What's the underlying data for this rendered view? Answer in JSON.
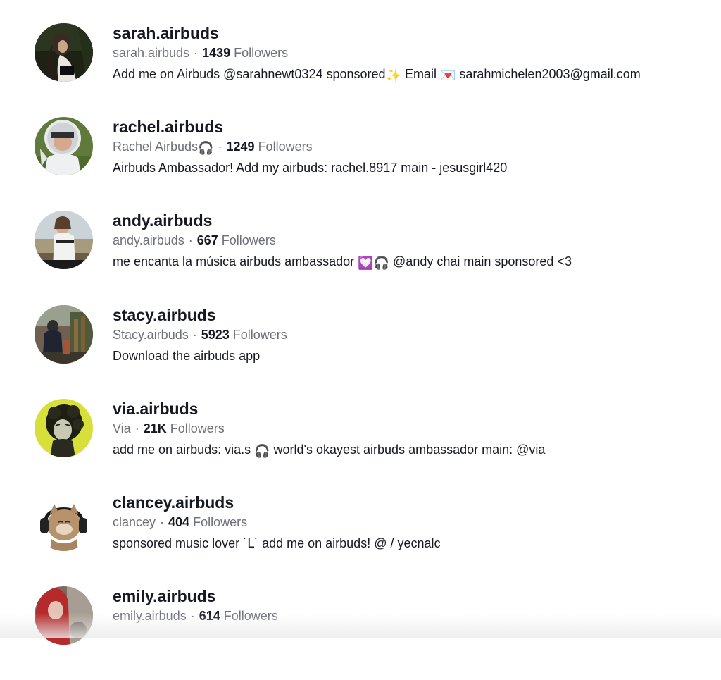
{
  "accounts": [
    {
      "username": "sarah.airbuds",
      "display_name": "sarah.airbuds",
      "followers_count": "1439",
      "followers_label": "Followers",
      "bio_parts": [
        "Add me on Airbuds @sarahnewt0324 sponsored",
        "✨",
        " Email ",
        "💌",
        " sarahmichelen2003@gmail.com"
      ],
      "avatar_icon": "woman-portrait-dark-avatar"
    },
    {
      "username": "rachel.airbuds",
      "display_name": "Rachel Airbuds",
      "display_emoji": "🎧",
      "followers_count": "1249",
      "followers_label": "Followers",
      "bio": "Airbuds Ambassador! Add my airbuds: rachel.8917 main - jesusgirl420",
      "avatar_icon": "helmet-girl-avatar"
    },
    {
      "username": "andy.airbuds",
      "display_name": "andy.airbuds",
      "followers_count": "667",
      "followers_label": "Followers",
      "bio_parts": [
        "me encanta la música airbuds ambassador ",
        "💟",
        "🎧",
        " @andy chai main sponsored <3"
      ],
      "avatar_icon": "girl-beach-avatar"
    },
    {
      "username": "stacy.airbuds",
      "display_name": "Stacy.airbuds",
      "followers_count": "5923",
      "followers_label": "Followers",
      "bio": "Download the airbuds app",
      "avatar_icon": "market-scene-avatar"
    },
    {
      "username": "via.airbuds",
      "display_name": "Via",
      "followers_count": "21K",
      "followers_label": "Followers",
      "bio_parts": [
        "add me on airbuds: via.s ",
        "🎧",
        " world's okayest airbuds ambassador main: @via"
      ],
      "avatar_icon": "curly-hair-yellow-avatar"
    },
    {
      "username": "clancey.airbuds",
      "display_name": "clancey",
      "followers_count": "404",
      "followers_label": "Followers",
      "bio": "sponsored music lover ˙ᒪ˙ add me on airbuds! @ / yecnalc",
      "avatar_icon": "cat-headphones-avatar"
    },
    {
      "username": "emily.airbuds",
      "display_name": "emily.airbuds",
      "followers_count": "614",
      "followers_label": "Followers",
      "bio": "",
      "avatar_icon": "red-hair-avatar"
    }
  ],
  "meta_separator": "·",
  "colors": {
    "primary_text": "#161823",
    "secondary_text": "#6e7079"
  }
}
